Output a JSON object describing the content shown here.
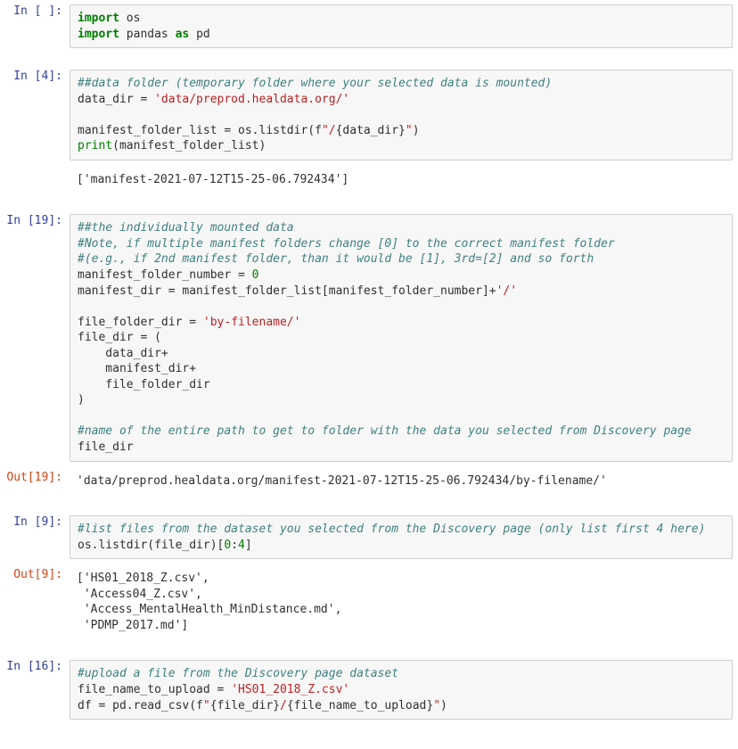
{
  "cells": [
    {
      "prompt_in": "In [ ]:",
      "code_html": "<span class='c-kw'>import</span> os\n<span class='c-kw'>import</span> pandas <span class='c-kw'>as</span> pd"
    },
    {
      "prompt_in": "In [4]:",
      "code_html": "<span class='c-com'>##data folder (temporary folder where your selected data is mounted)</span>\ndata_dir = <span class='c-str'>'data/preprod.healdata.org/'</span>\n\nmanifest_folder_list = os.listdir(f<span class='c-str'>\"/</span>{data_dir}<span class='c-str'>\"</span>)\n<span class='c-builtin'>print</span>(manifest_folder_list)",
      "stream_out": "['manifest-2021-07-12T15-25-06.792434']"
    },
    {
      "prompt_in": "In [19]:",
      "prompt_out": "Out[19]:",
      "code_html": "<span class='c-com'>##the individually mounted data</span>\n<span class='c-com'>#Note, if multiple manifest folders change [0] to the correct manifest folder</span>\n<span class='c-com'>#(e.g., if 2nd manifest folder, than it would be [1], 3rd=[2] and so forth</span>\nmanifest_folder_number = <span class='c-num'>0</span>\nmanifest_dir = manifest_folder_list[manifest_folder_number]+<span class='c-str'>'/'</span>\n\nfile_folder_dir = <span class='c-str'>'by-filename/'</span>\nfile_dir = (\n    data_dir+\n    manifest_dir+\n    file_folder_dir\n)\n\n<span class='c-com'>#name of the entire path to get to folder with the data you selected from Discovery page</span>\nfile_dir",
      "result_out": "'data/preprod.healdata.org/manifest-2021-07-12T15-25-06.792434/by-filename/'"
    },
    {
      "prompt_in": "In [9]:",
      "prompt_out": "Out[9]:",
      "code_html": "<span class='c-com'>#list files from the dataset you selected from the Discovery page (only list first 4 here)</span>\nos.listdir(file_dir)[<span class='c-num'>0</span>:<span class='c-num'>4</span>]",
      "result_out": "['HS01_2018_Z.csv',\n 'Access04_Z.csv',\n 'Access_MentalHealth_MinDistance.md',\n 'PDMP_2017.md']"
    },
    {
      "prompt_in": "In [16]:",
      "code_html": "<span class='c-com'>#upload a file from the Discovery page dataset</span>\nfile_name_to_upload = <span class='c-str'>'HS01_2018_Z.csv'</span>\ndf = pd.read_csv(f<span class='c-str'>\"</span>{file_dir}<span class='c-str'>/</span>{file_name_to_upload}<span class='c-str'>\"</span>)"
    }
  ]
}
